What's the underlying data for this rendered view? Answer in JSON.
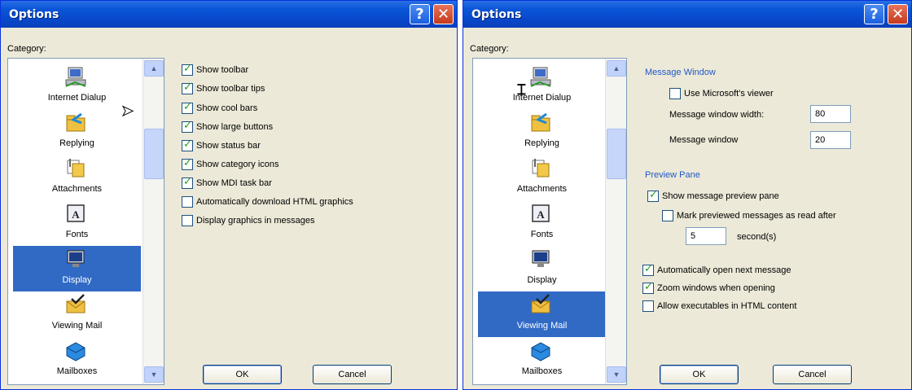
{
  "left_window": {
    "title": "Options",
    "help_label": "?",
    "close_label": "✕",
    "category_label": "Category:",
    "categories": [
      {
        "label": "Internet Dialup",
        "icon": "computer-network-icon"
      },
      {
        "label": "Replying",
        "icon": "folder-reply-icon"
      },
      {
        "label": "Attachments",
        "icon": "attachments-icon"
      },
      {
        "label": "Fonts",
        "icon": "font-icon"
      },
      {
        "label": "Display",
        "icon": "monitor-icon",
        "selected": true
      },
      {
        "label": "Viewing Mail",
        "icon": "envelope-check-icon"
      },
      {
        "label": "Mailboxes",
        "icon": "mailbox-tray-icon"
      }
    ],
    "checkboxes": [
      {
        "label": "Show toolbar",
        "checked": true
      },
      {
        "label": "Show toolbar tips",
        "checked": true
      },
      {
        "label": "Show cool bars",
        "checked": true
      },
      {
        "label": "Show large buttons",
        "checked": true
      },
      {
        "label": "Show status bar",
        "checked": true
      },
      {
        "label": "Show category icons",
        "checked": true
      },
      {
        "label": "Show MDI task bar",
        "checked": true
      },
      {
        "label": "Automatically download HTML graphics",
        "checked": false
      },
      {
        "label": "Display graphics in messages",
        "checked": false
      }
    ],
    "ok_label": "OK",
    "cancel_label": "Cancel"
  },
  "right_window": {
    "title": "Options",
    "help_label": "?",
    "close_label": "✕",
    "category_label": "Category:",
    "categories": [
      {
        "label": "Internet Dialup",
        "icon": "computer-network-icon"
      },
      {
        "label": "Replying",
        "icon": "folder-reply-icon"
      },
      {
        "label": "Attachments",
        "icon": "attachments-icon"
      },
      {
        "label": "Fonts",
        "icon": "font-icon"
      },
      {
        "label": "Display",
        "icon": "monitor-icon"
      },
      {
        "label": "Viewing Mail",
        "icon": "envelope-check-icon",
        "selected": true
      },
      {
        "label": "Mailboxes",
        "icon": "mailbox-tray-icon"
      }
    ],
    "message_window": {
      "heading": "Message Window",
      "use_viewer": {
        "label": "Use Microsoft's viewer",
        "checked": false
      },
      "width_label": "Message window width:",
      "width_value": "80",
      "height_label": "Message window",
      "height_value": "20"
    },
    "preview_pane": {
      "heading": "Preview Pane",
      "show_preview": {
        "label": "Show message preview pane",
        "checked": true
      },
      "mark_read": {
        "label": "Mark previewed messages as read after",
        "checked": false
      },
      "seconds_value": "5",
      "seconds_label": "second(s)"
    },
    "options": [
      {
        "label": "Automatically open next message",
        "checked": true
      },
      {
        "label": "Zoom windows when opening",
        "checked": true
      },
      {
        "label": "Allow executables in HTML content",
        "checked": false
      }
    ],
    "ok_label": "OK",
    "cancel_label": "Cancel"
  },
  "colors": {
    "titlebar": "#0a56d8",
    "selection": "#316ac5",
    "dialog_bg": "#ece9d8",
    "group_heading": "#2158c8",
    "checkmark": "#21a121"
  }
}
